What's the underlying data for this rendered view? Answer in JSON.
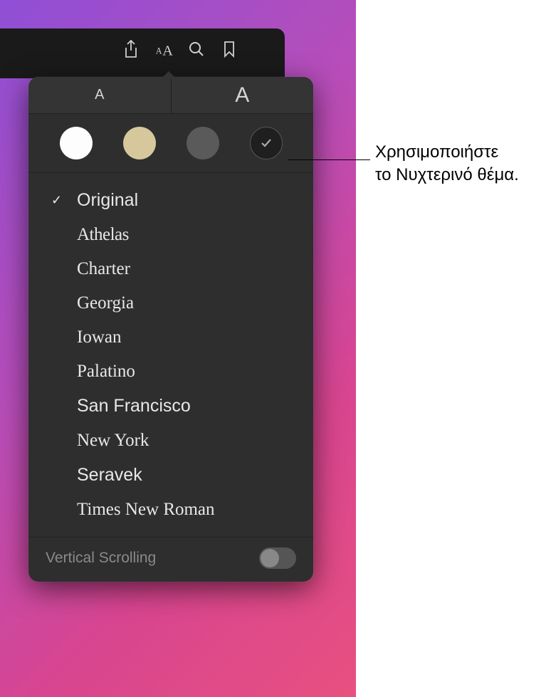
{
  "toolbar": {
    "share_icon": "share-icon",
    "appearance_icon": "appearance-icon",
    "search_icon": "search-icon",
    "bookmark_icon": "bookmark-icon"
  },
  "size_row": {
    "small_label": "A",
    "large_label": "A"
  },
  "themes": {
    "white": "#fdfdfd",
    "sepia": "#d6c79d",
    "gray": "#5a5a5a",
    "night": "#1f1f1f",
    "night_selected": true
  },
  "fonts": [
    {
      "name": "Original",
      "selected": true,
      "class": "font-original"
    },
    {
      "name": "Athelas",
      "selected": false,
      "class": "font-athelas"
    },
    {
      "name": "Charter",
      "selected": false,
      "class": "font-charter"
    },
    {
      "name": "Georgia",
      "selected": false,
      "class": "font-georgia"
    },
    {
      "name": "Iowan",
      "selected": false,
      "class": "font-iowan"
    },
    {
      "name": "Palatino",
      "selected": false,
      "class": "font-palatino"
    },
    {
      "name": "San Francisco",
      "selected": false,
      "class": "font-sf"
    },
    {
      "name": "New York",
      "selected": false,
      "class": "font-ny"
    },
    {
      "name": "Seravek",
      "selected": false,
      "class": "font-seravek"
    },
    {
      "name": "Times New Roman",
      "selected": false,
      "class": "font-times"
    }
  ],
  "scroll": {
    "label": "Vertical Scrolling",
    "enabled": false
  },
  "callout": {
    "line1": "Χρησιμοποιήστε",
    "line2": "το Νυχτερινό θέμα."
  }
}
